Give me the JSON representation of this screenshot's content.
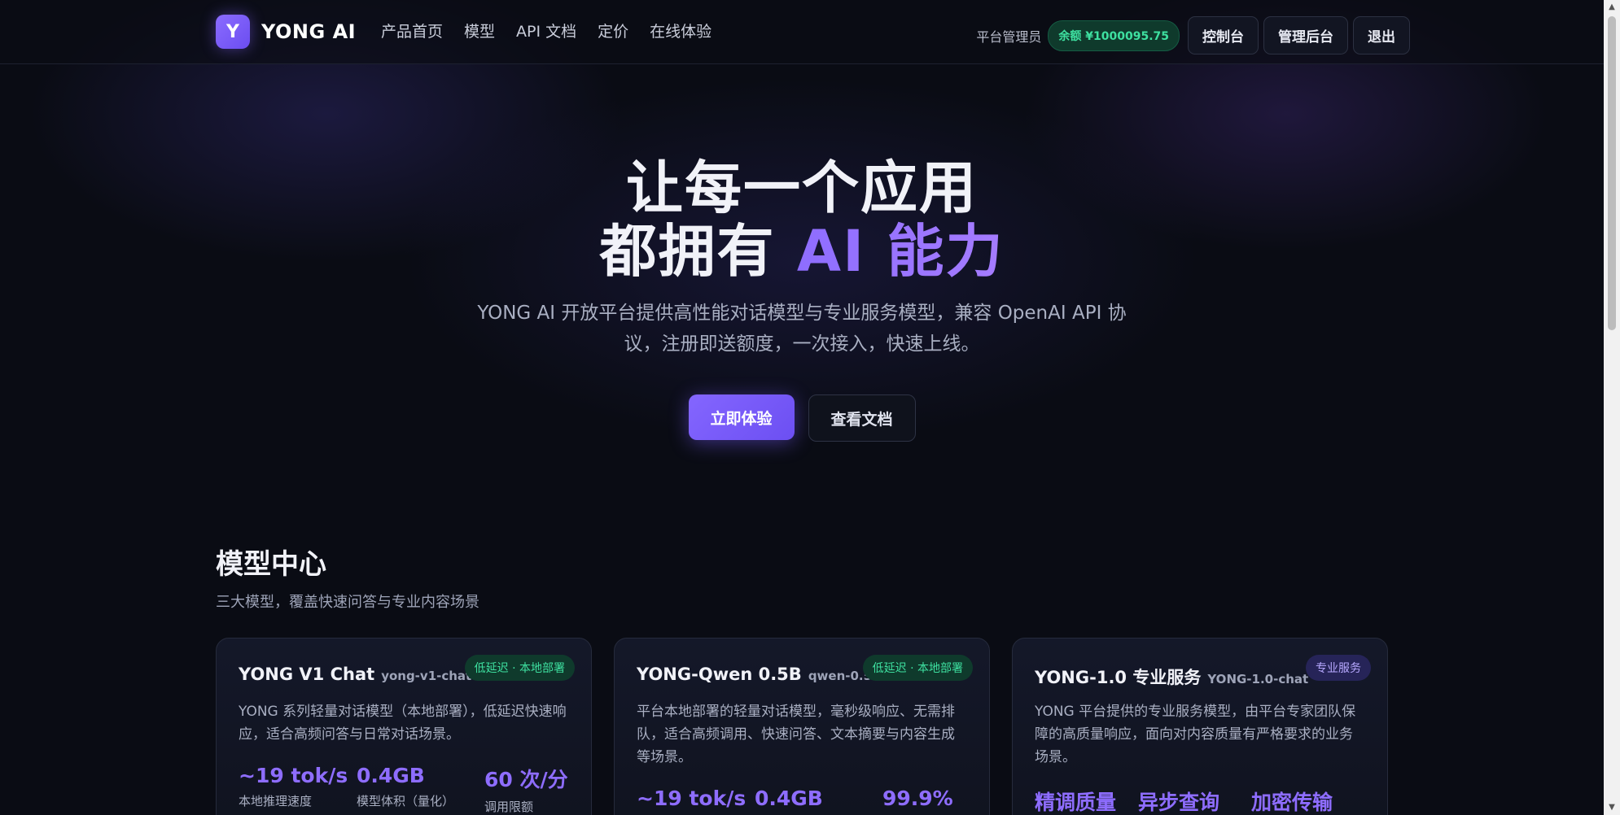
{
  "header": {
    "logo_letter": "Y",
    "brand": "YONG AI",
    "nav": [
      "产品首页",
      "模型",
      "API 文档",
      "定价",
      "在线体验"
    ],
    "role": "平台管理员",
    "balance": "余额 ¥1000095.75",
    "buttons": [
      "控制台",
      "管理后台",
      "退出"
    ]
  },
  "hero": {
    "title_line1": "让每一个应用",
    "title_line2_prefix": "都拥有 ",
    "title_line2_accent": "AI 能力",
    "subtitle": "YONG AI 开放平台提供高性能对话模型与专业服务模型，兼容 OpenAI API 协议，注册即送额度，一次接入，快速上线。",
    "primary_button": "立即体验",
    "secondary_button": "查看文档"
  },
  "models": {
    "title": "模型中心",
    "subtitle": "三大模型，覆盖快速问答与专业内容场景",
    "cards": [
      {
        "name": "YONG V1 Chat",
        "id": "yong-v1-chat",
        "badge": "低延迟 · 本地部署",
        "description": "YONG 系列轻量对话模型（本地部署），低延迟快速响应，适合高频问答与日常对话场景。",
        "stats": [
          {
            "value": "~19 tok/s",
            "label": "本地推理速度"
          },
          {
            "value": "0.4GB",
            "label": "模型体积（量化）"
          },
          {
            "value": "60 次/分",
            "label": "调用限额"
          }
        ]
      },
      {
        "name": "YONG-Qwen 0.5B",
        "id": "qwen-0.5b-chat",
        "badge": "低延迟 · 本地部署",
        "description": "平台本地部署的轻量对话模型，毫秒级响应、无需排队，适合高频调用、快速问答、文本摘要与内容生成等场景。",
        "stats": [
          {
            "value": "~19 tok/s",
            "label": ""
          },
          {
            "value": "0.4GB",
            "label": ""
          },
          {
            "value": "99.9%",
            "label": ""
          }
        ]
      },
      {
        "name": "YONG-1.0 专业服务",
        "id": "YONG-1.0-chat",
        "badge": "专业服务",
        "description": "YONG 平台提供的专业服务模型，由平台专家团队保障的高质量响应，面向对内容质量有严格要求的业务场景。",
        "stats": [
          {
            "value": "精调质量",
            "label": ""
          },
          {
            "value": "异步查询",
            "label": ""
          },
          {
            "value": "加密传输",
            "label": ""
          }
        ]
      }
    ]
  },
  "colors": {
    "background": "#0a0c14",
    "accent": "#8e6dff",
    "success": "#3ee0a0"
  }
}
